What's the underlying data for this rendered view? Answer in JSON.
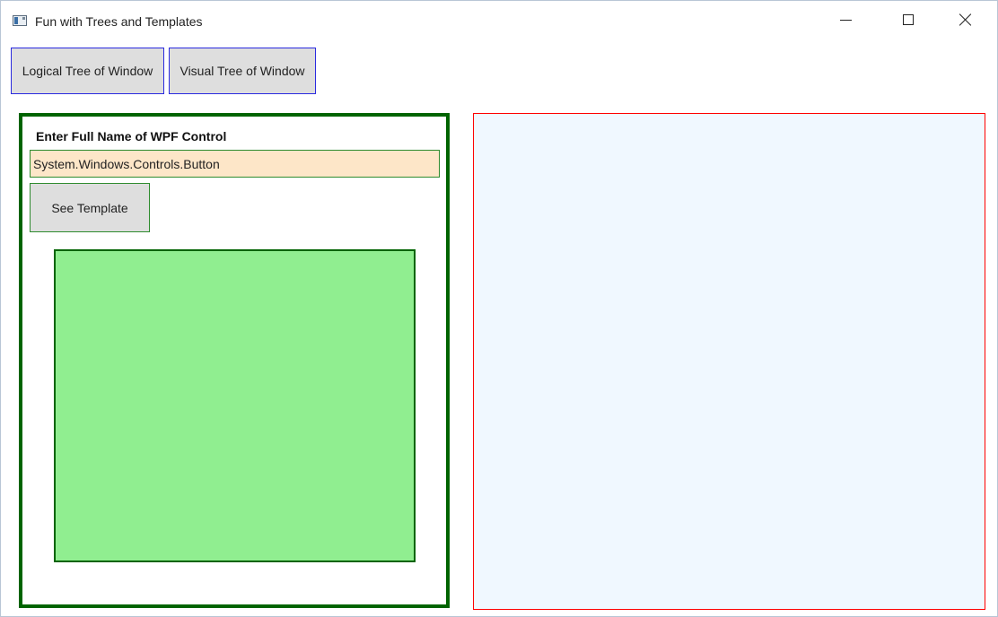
{
  "window": {
    "title": "Fun with Trees and Templates",
    "icons": {
      "app": "app-window-icon",
      "minimize": "minimize-icon",
      "maximize": "maximize-icon",
      "close": "close-icon"
    }
  },
  "toolbar": {
    "logical_tree_label": "Logical Tree of Window",
    "visual_tree_label": "Visual Tree of Window"
  },
  "left_panel": {
    "prompt_label": "Enter Full Name of WPF Control",
    "control_name_value": "System.Windows.Controls.Button",
    "see_template_label": "See Template"
  },
  "colors": {
    "panel_border": "#006400",
    "preview_fill": "#90ee90",
    "input_fill": "#fde6c8",
    "output_border": "#ff0000",
    "output_fill": "#f0f8ff",
    "toolbar_button_border": "#2a2adf"
  }
}
